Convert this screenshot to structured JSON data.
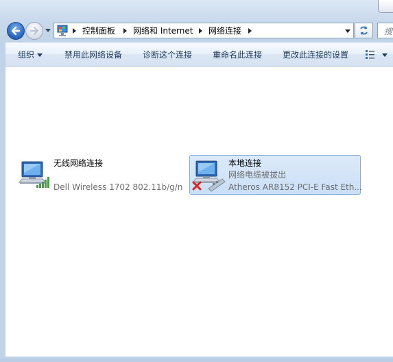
{
  "address": {
    "crumbs": [
      "控制面板",
      "网络和 Internet",
      "网络连接"
    ]
  },
  "search": {
    "placeholder": "搜"
  },
  "toolbar": {
    "organize": "组织",
    "disable_device": "禁用此网络设备",
    "diagnose": "诊断这个连接",
    "rename": "重命名此连接",
    "change_settings": "更改此连接的设置"
  },
  "connections": [
    {
      "name": "无线网络连接",
      "status": "",
      "device": "Dell Wireless 1702 802.11b/g/n",
      "selected": false
    },
    {
      "name": "本地连接",
      "status": "网络电缆被拔出",
      "device": "Atheros AR8152 PCI-E Fast Eth...",
      "selected": true
    }
  ],
  "icons": {
    "back": "back-arrow-icon",
    "forward": "forward-arrow-icon",
    "refresh": "refresh-icon",
    "network": "network-computer-icon",
    "signal": "signal-bars-icon",
    "unplugged": "red-x-icon"
  },
  "colors": {
    "selection": "#cce0f7",
    "toolbar_text": "#1e395b",
    "secondary_text": "#6d6d6d"
  }
}
